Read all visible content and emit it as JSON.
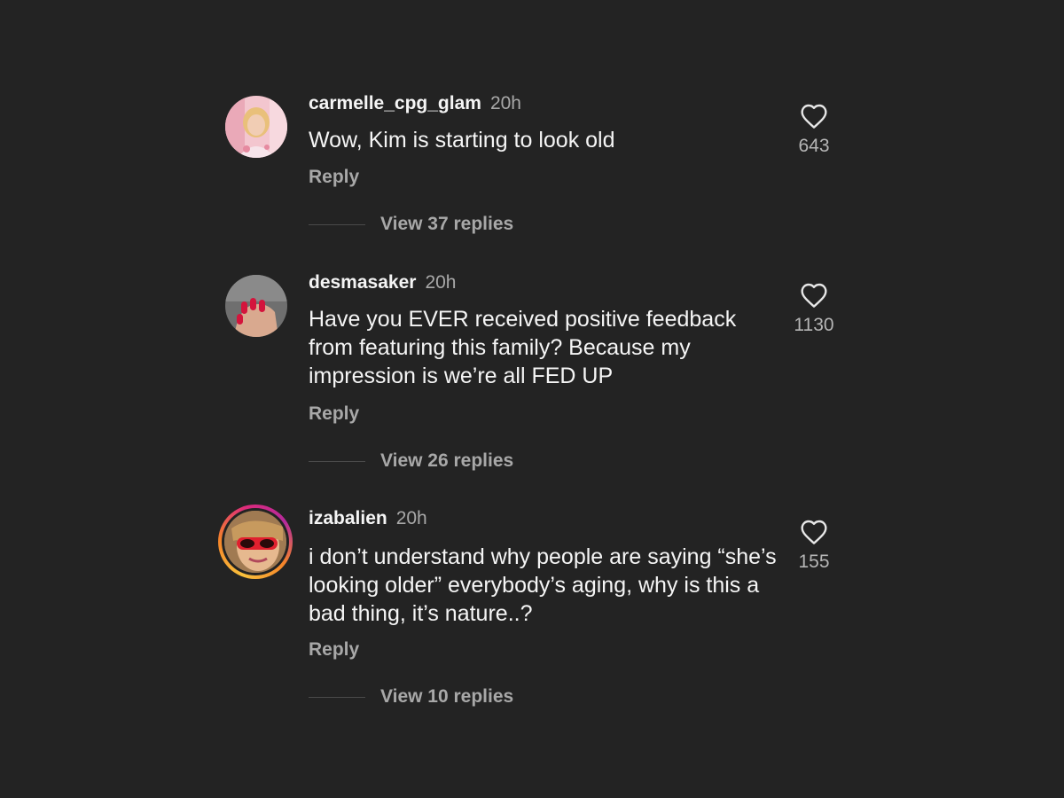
{
  "comments": [
    {
      "username": "carmelle_cpg_glam",
      "time": "20h",
      "text": "Wow, Kim is starting to look old",
      "reply_label": "Reply",
      "view_replies": "View 37 replies",
      "likes": "643",
      "avatar_icon": "profile-photo",
      "has_story_ring": false
    },
    {
      "username": "desmasaker",
      "time": "20h",
      "text": "Have you EVER received positive feedback from featuring this family? Because my impression is we’re all FED UP",
      "reply_label": "Reply",
      "view_replies": "View 26 replies",
      "likes": "1130",
      "avatar_icon": "profile-photo",
      "has_story_ring": false
    },
    {
      "username": "izabalien",
      "time": "20h",
      "text": "i don’t understand why people are saying “she’s looking older” everybody’s aging, why is this a bad thing, it’s nature..?",
      "reply_label": "Reply",
      "view_replies": "View 10 replies",
      "likes": "155",
      "avatar_icon": "profile-photo",
      "has_story_ring": true
    }
  ],
  "colors": {
    "background": "#232323",
    "primary_text": "#f5f5f5",
    "secondary_text": "#a8a8a8",
    "story_ring_start": "#f9c13c",
    "story_ring_end": "#dd2a7b"
  },
  "icons": {
    "like": "heart-outline-icon"
  }
}
